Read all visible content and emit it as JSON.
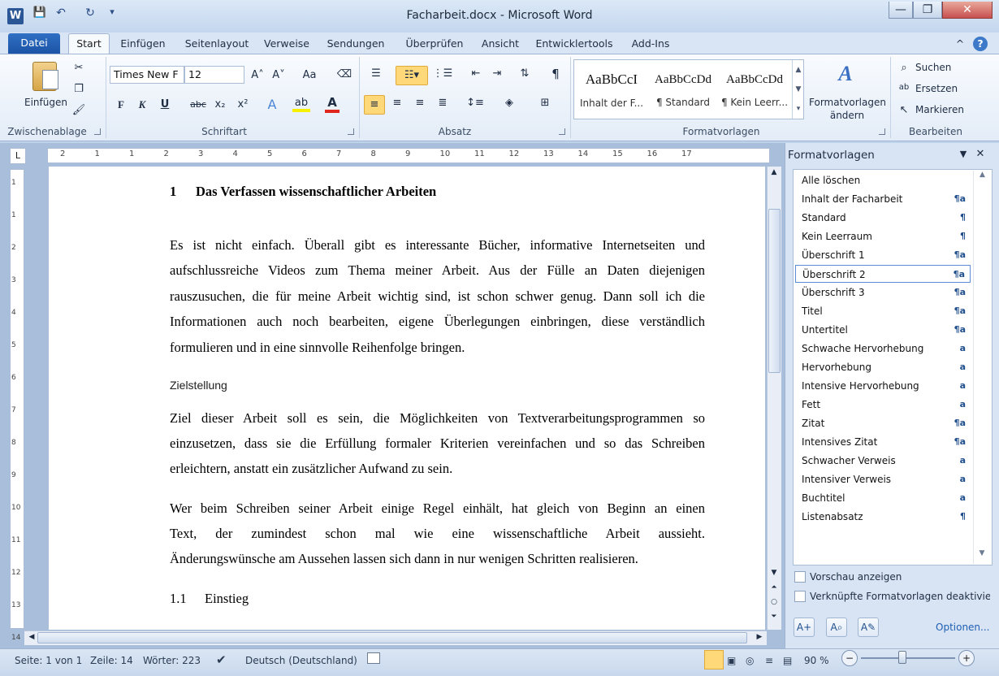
{
  "window": {
    "title": "Facharbeit.docx  -  Microsoft Word",
    "app_icon": "W",
    "controls": {
      "minimize": "—",
      "maximize": "❐",
      "close": "✕"
    }
  },
  "qat": {
    "save_icon": "💾",
    "undo_icon": "↶",
    "redo_icon": "↻",
    "customize_icon": "▾"
  },
  "tabs": {
    "file": "Datei",
    "items": [
      "Start",
      "Einfügen",
      "Seitenlayout",
      "Verweise",
      "Sendungen",
      "Überprüfen",
      "Ansicht",
      "Entwicklertools",
      "Add-Ins"
    ],
    "minimize_icon": "^",
    "help_icon": "?"
  },
  "ribbon": {
    "clipboard": {
      "label": "Zwischenablage",
      "paste": "Einfügen"
    },
    "font": {
      "label": "Schriftart",
      "family": "Times New F",
      "size": "12",
      "grow": "A˄",
      "shrink": "A˅",
      "case": "Aa",
      "bold": "F",
      "italic": "K",
      "underline": "U",
      "strike": "abc",
      "sub": "x₂",
      "sup": "x²",
      "effects": "A",
      "highlight": "ab",
      "color": "A"
    },
    "paragraph": {
      "label": "Absatz",
      "pilcrow": "¶"
    },
    "styles": {
      "label": "Formatvorlagen",
      "items": [
        {
          "preview": "AaBbCcI",
          "name": "Inhalt der F..."
        },
        {
          "preview": "AaBbCcDd",
          "name": "¶ Standard"
        },
        {
          "preview": "AaBbCcDd",
          "name": "¶ Kein Leerr..."
        }
      ],
      "change_line1": "Formatvorlagen",
      "change_line2": "ändern"
    },
    "editing": {
      "label": "Bearbeiten",
      "find": "Suchen",
      "replace": "Ersetzen",
      "select": "Markieren"
    }
  },
  "ruler": {
    "numbers": [
      "2",
      "1",
      "1",
      "2",
      "3",
      "4",
      "5",
      "6",
      "7",
      "8",
      "9",
      "10",
      "11",
      "12",
      "13",
      "14",
      "15",
      "16",
      "17"
    ]
  },
  "vruler": {
    "numbers": [
      "1",
      "1",
      "2",
      "3",
      "4",
      "5",
      "6",
      "7",
      "8",
      "9",
      "10",
      "11",
      "12",
      "13",
      "14"
    ]
  },
  "document": {
    "heading1": {
      "num": "1",
      "text": "Das Verfassen wissenschaftlicher Arbeiten"
    },
    "para1": [
      "Es ist nicht einfach. Überall gibt es interessante Bücher, informative Internetseiten und",
      "aufschlussreiche Videos zum Thema meiner Arbeit. Aus der Fülle an Daten diejenigen",
      "rauszusuchen, die für meine Arbeit wichtig sind, ist schon schwer genug. Dann soll ich die",
      "Informationen auch noch bearbeiten, eigene Überlegungen einbringen, diese verständlich",
      "formulieren und in eine sinnvolle Reihenfolge bringen."
    ],
    "subheading": "Zielstellung",
    "para2": [
      "Ziel dieser Arbeit soll es sein, die Möglichkeiten von Textverarbeitungsprogrammen so",
      "einzusetzen, dass sie die Erfüllung formaler Kriterien vereinfachen und so das Schreiben",
      "erleichtern, anstatt ein zusätzlicher Aufwand zu sein."
    ],
    "para3": [
      "Wer beim Schreiben seiner Arbeit einige Regel einhält, hat gleich von Beginn an einen",
      "Text, der zumindest schon mal wie eine wissenschaftliche Arbeit aussieht.",
      "Änderungswünsche am Aussehen lassen sich dann in nur wenigen Schritten realisieren."
    ],
    "heading2": {
      "num": "1.1",
      "text": "Einstieg"
    }
  },
  "pane": {
    "title": "Formatvorlagen",
    "menu_icon": "▼",
    "close_icon": "✕",
    "items": [
      {
        "name": "Alle löschen",
        "icon": ""
      },
      {
        "name": "Inhalt der Facharbeit",
        "icon": "¶a"
      },
      {
        "name": "Standard",
        "icon": "¶"
      },
      {
        "name": "Kein Leerraum",
        "icon": "¶"
      },
      {
        "name": "Überschrift 1",
        "icon": "¶a"
      },
      {
        "name": "Überschrift 2",
        "icon": "¶a"
      },
      {
        "name": "Überschrift 3",
        "icon": "¶a"
      },
      {
        "name": "Titel",
        "icon": "¶a"
      },
      {
        "name": "Untertitel",
        "icon": "¶a"
      },
      {
        "name": "Schwache Hervorhebung",
        "icon": "a"
      },
      {
        "name": "Hervorhebung",
        "icon": "a"
      },
      {
        "name": "Intensive Hervorhebung",
        "icon": "a"
      },
      {
        "name": "Fett",
        "icon": "a"
      },
      {
        "name": "Zitat",
        "icon": "¶a"
      },
      {
        "name": "Intensives Zitat",
        "icon": "¶a"
      },
      {
        "name": "Schwacher Verweis",
        "icon": "a"
      },
      {
        "name": "Intensiver Verweis",
        "icon": "a"
      },
      {
        "name": "Buchtitel",
        "icon": "a"
      },
      {
        "name": "Listenabsatz",
        "icon": "¶"
      }
    ],
    "selected": "Überschrift 2",
    "preview_label": "Vorschau anzeigen",
    "linked_label": "Verknüpfte Formatvorlagen deaktiviere",
    "options_link": "Optionen..."
  },
  "status": {
    "page": "Seite: 1 von 1",
    "line": "Zeile: 14",
    "words": "Wörter: 223",
    "language": "Deutsch (Deutschland)",
    "zoom": "90 %",
    "zoom_out": "−",
    "zoom_in": "+"
  }
}
